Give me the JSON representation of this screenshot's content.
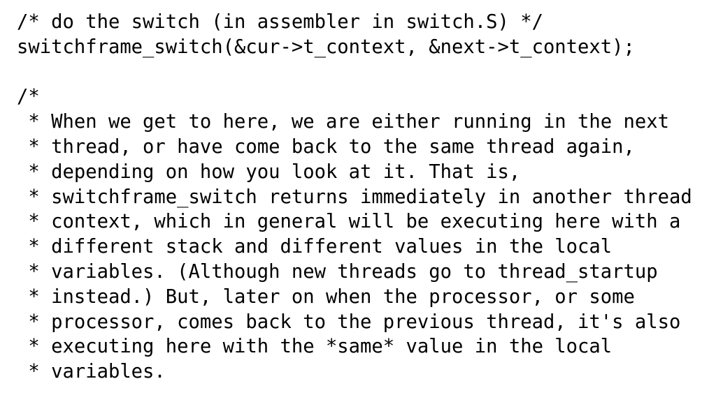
{
  "document": {
    "kind": "source-code-comment",
    "language": "c",
    "background_color": "#ffffff",
    "text_color": "#000000",
    "lines": [
      "/* do the switch (in assembler in switch.S) */",
      "switchframe_switch(&cur->t_context, &next->t_context);",
      "",
      "/*",
      " * When we get to here, we are either running in the next",
      " * thread, or have come back to the same thread again,",
      " * depending on how you look at it. That is,",
      " * switchframe_switch returns immediately in another thread",
      " * context, which in general will be executing here with a",
      " * different stack and different values in the local",
      " * variables. (Although new threads go to thread_startup",
      " * instead.) But, later on when the processor, or some",
      " * processor, comes back to the previous thread, it's also",
      " * executing here with the *same* value in the local",
      " * variables."
    ]
  }
}
